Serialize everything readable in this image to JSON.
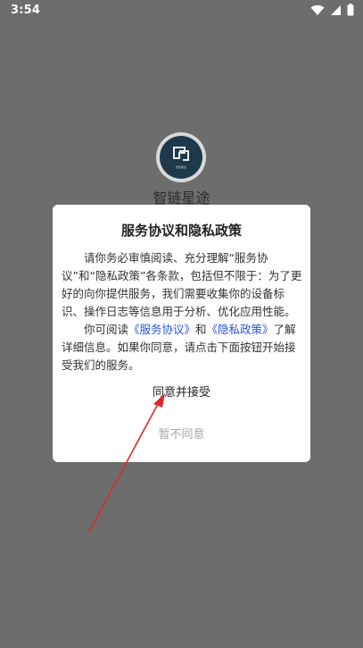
{
  "status_bar": {
    "time": "3:54",
    "icons": [
      "wifi-icon",
      "signal-icon",
      "battery-icon"
    ]
  },
  "app": {
    "name": "智链星途",
    "logo_caption": "智链星途",
    "colors": {
      "logo_bg": "#1e3a4a",
      "overlay": "#6d6d6d"
    }
  },
  "dialog": {
    "title": "服务协议和隐私政策",
    "para1": "请你务必审慎阅读、充分理解“服务协议”和“隐私政策”各条款，包括但不限于：为了更好的向你提供服务，我们需要收集你的设备标识、操作日志等信息用于分析、优化应用性能。",
    "para2_prefix": "你可阅读",
    "service_link": "《服务协议》",
    "para2_and": "和",
    "privacy_link": "《隐私政策》",
    "para2_suffix": "了解详细信息。如果你同意，请点击下面按钮开始接受我们的服务。",
    "agree_label": "同意并接受",
    "disagree_label": "暂不同意",
    "colors": {
      "link": "#2b55d8",
      "disagree": "#a8a8a8"
    }
  }
}
